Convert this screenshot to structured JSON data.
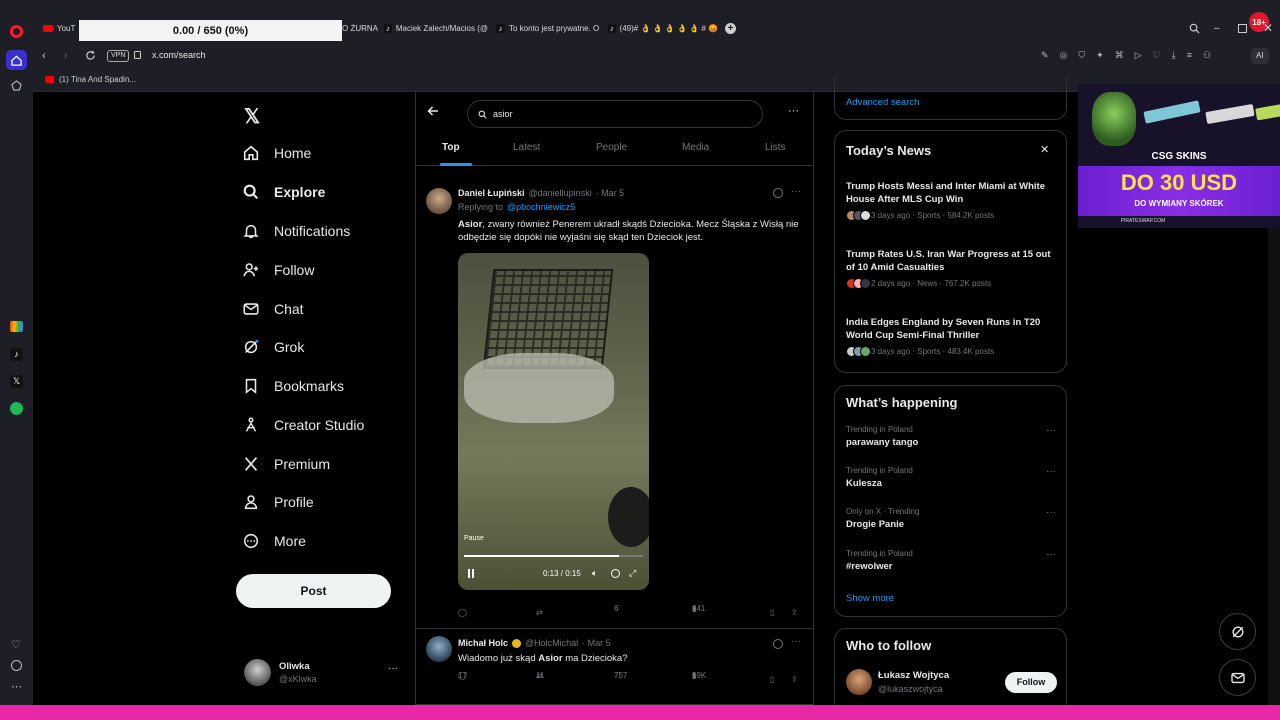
{
  "browser": {
    "media_overlay": "0.00 / 650 (0%)",
    "tabs": [
      {
        "label": "YouT"
      },
      {
        "label": "O ŻURNA"
      },
      {
        "label": "Maciek Zalech/Macios (@"
      },
      {
        "label": "To konto jest prywatne. O"
      },
      {
        "label": "(49)# 👌 👌 👌 👌 👌 # 😡"
      }
    ],
    "vpn_label": "VPN",
    "url": "x.com/search",
    "ai_label": "AI",
    "bookmark": "(1) Tina And Spadin...",
    "notif_badge": "18+"
  },
  "nav": {
    "items": [
      {
        "label": "Home",
        "icon": "home-icon"
      },
      {
        "label": "Explore",
        "icon": "search-icon"
      },
      {
        "label": "Notifications",
        "icon": "bell-icon"
      },
      {
        "label": "Follow",
        "icon": "add-person-icon"
      },
      {
        "label": "Chat",
        "icon": "mail-icon"
      },
      {
        "label": "Grok",
        "icon": "grok-icon"
      },
      {
        "label": "Bookmarks",
        "icon": "bookmark-icon"
      },
      {
        "label": "Creator Studio",
        "icon": "creator-icon"
      },
      {
        "label": "Premium",
        "icon": "x-icon"
      },
      {
        "label": "Profile",
        "icon": "person-icon"
      },
      {
        "label": "More",
        "icon": "more-icon"
      }
    ],
    "post_label": "Post",
    "account": {
      "name": "Oliwka",
      "handle": "@xKlwka"
    }
  },
  "search": {
    "query": "asior",
    "tabs": [
      "Top",
      "Latest",
      "People",
      "Media",
      "Lists"
    ]
  },
  "tweets": [
    {
      "name": "Daniel Łupiński",
      "handle": "@daniellupinski",
      "date": "· Mar 5",
      "replying_prefix": "Replying to",
      "replying_to": "@pbochniewicz5",
      "text_bold": "Asior",
      "text_rest": ", zwany również Penerem ukradł skądś Dzieciokа. Mecz Śląska z Wisłą nie odbędzie się dopóki nie wyjaśni się skąd ten Dzieciok jest.",
      "video": {
        "pause_tooltip": "Pause",
        "time": "0:13 / 0:15",
        "progress": 0.867
      },
      "likes": "6",
      "views": "641"
    },
    {
      "name": "Michał Holc",
      "handle": "@HolcMichal",
      "date": "· Mar 5",
      "text_pre": "Wiadomo już skąd ",
      "text_bold": "Asior",
      "text_post": " ma Dzieciokа?",
      "replies": "17",
      "retweets": "11",
      "likes": "757",
      "views": "59K"
    }
  ],
  "right": {
    "advanced_search": "Advanced search",
    "news_title": "Today’s News",
    "news": [
      {
        "headline": "Trump Hosts Messi and Inter Miami at White House After MLS Cup Win",
        "meta": "3 days ago · Sports · 584.2K posts"
      },
      {
        "headline": "Trump Rates U.S. Iran War Progress at 15 out of 10 Amid Casualties",
        "meta": "2 days ago · News · 767.2K posts"
      },
      {
        "headline": "India Edges England by Seven Runs in T20 World Cup Semi-Final Thriller",
        "meta": "3 days ago · Sports · 483.4K posts"
      }
    ],
    "happening_title": "What’s happening",
    "trends": [
      {
        "context": "Trending in Poland",
        "name": "parawany tango"
      },
      {
        "context": "Trending in Poland",
        "name": "Kulesza"
      },
      {
        "context": "Only on X · Trending",
        "name": "Drogie Panie"
      },
      {
        "context": "Trending in Poland",
        "name": "#rewolwer"
      }
    ],
    "show_more": "Show more",
    "who_title": "Who to follow",
    "follow": {
      "name": "Łukasz Wojtyca",
      "handle": "@lukaszwojtyca",
      "button": "Follow"
    }
  },
  "ad": {
    "brand": "CSG SKINS",
    "headline": "DO 30 USD",
    "subline": "DO WYMIANY SKÓREK",
    "url": "PIRATESWAP.COM"
  },
  "colors": {
    "accent": "#1d9bf0",
    "opera_red": "#ff1b2d",
    "pink_bar": "#e62aa6"
  }
}
